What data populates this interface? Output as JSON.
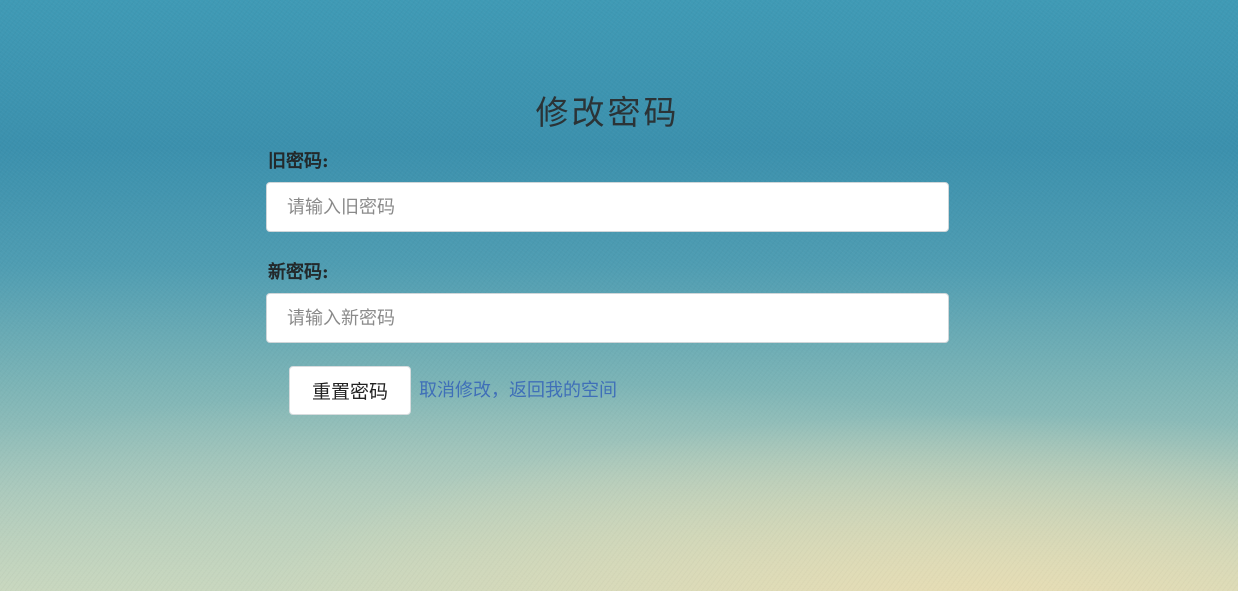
{
  "page": {
    "title": "修改密码"
  },
  "form": {
    "old_password": {
      "label": "旧密码:",
      "placeholder": "请输入旧密码",
      "value": ""
    },
    "new_password": {
      "label": "新密码:",
      "placeholder": "请输入新密码",
      "value": ""
    },
    "submit_label": "重置密码",
    "cancel_link_text": "取消修改，返回我的空间"
  },
  "colors": {
    "background_top": "#3f9ab5",
    "background_bottom": "#c9d8bf",
    "link": "#3f6fb8",
    "input_background": "#ffffff"
  }
}
